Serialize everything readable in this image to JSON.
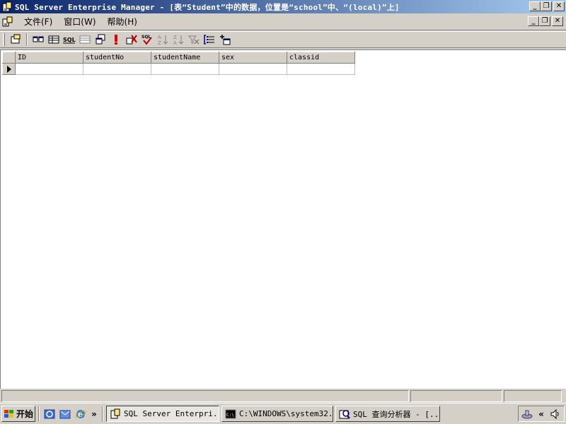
{
  "window": {
    "title": "SQL Server Enterprise Manager - [表“Student”中的数据，位置是“school”中、“(local)”上]"
  },
  "menu": {
    "items": [
      "文件(F)",
      "窗口(W)",
      "帮助(H)"
    ]
  },
  "toolbar": {
    "icons": [
      "properties-icon",
      "show-diagram-pane-icon",
      "show-grid-pane-icon",
      "show-sql-pane-icon",
      "show-results-pane-icon",
      "change-query-type-icon",
      "run-icon",
      "clear-results-icon",
      "verify-sql-icon",
      "sort-ascending-icon",
      "sort-descending-icon",
      "remove-filter-icon",
      "group-by-icon",
      "add-table-icon"
    ]
  },
  "grid": {
    "columns": [
      "ID",
      "studentNo",
      "studentName",
      "sex",
      "classid"
    ],
    "rows": [
      [
        "",
        "",
        "",
        "",
        ""
      ]
    ]
  },
  "taskbar": {
    "start_label": "开始",
    "more_label": "»",
    "tasks": [
      {
        "label": "SQL Server Enterpri...",
        "active": true
      },
      {
        "label": "C:\\WINDOWS\\system32...",
        "active": false
      },
      {
        "label": "SQL 查询分析器 - [...",
        "active": false
      }
    ],
    "tray_chevron": "«"
  },
  "colors": {
    "title_gradient_start": "#0a246a",
    "title_gradient_end": "#a6caf0",
    "face": "#d4d0c8"
  }
}
